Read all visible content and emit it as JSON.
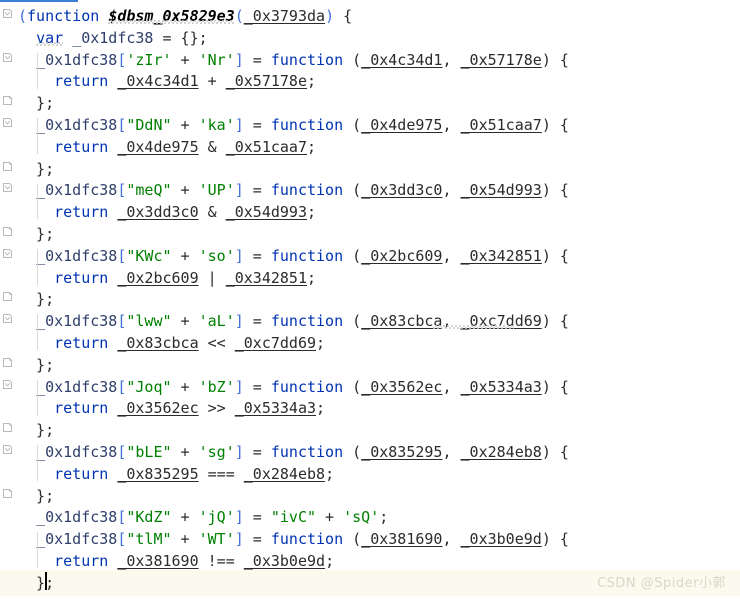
{
  "app": {
    "kind": "code-editor",
    "language": "JavaScript",
    "background": "#ffffff",
    "current_line_highlight": "#fcfaef",
    "accent": "#3a7fd5"
  },
  "colors": {
    "keyword": "#0033b3",
    "string": "#008000",
    "identifier": "#2f3f6b",
    "punctuation": "#3f6fd8",
    "plain": "#2b2b2b",
    "function_name": "#000000",
    "indent_guide": "#d8d8d8",
    "fold_marker": "#b9b9b9",
    "watermark": "#d9d6c8"
  },
  "watermark": {
    "text": "CSDN @Spider小郭"
  },
  "caret": {
    "line_index": 22,
    "column": 3
  },
  "gutter": {
    "markers": [
      {
        "line_index": 0,
        "icon": "fold-open-icon"
      },
      {
        "line_index": 2,
        "icon": "fold-open-icon"
      },
      {
        "line_index": 4,
        "icon": "fold-end-icon"
      },
      {
        "line_index": 5,
        "icon": "fold-open-icon"
      },
      {
        "line_index": 7,
        "icon": "fold-end-icon"
      },
      {
        "line_index": 8,
        "icon": "fold-open-icon"
      },
      {
        "line_index": 10,
        "icon": "fold-end-icon"
      },
      {
        "line_index": 11,
        "icon": "fold-open-icon"
      },
      {
        "line_index": 13,
        "icon": "fold-end-icon"
      },
      {
        "line_index": 14,
        "icon": "fold-open-icon"
      },
      {
        "line_index": 16,
        "icon": "fold-end-icon"
      },
      {
        "line_index": 17,
        "icon": "fold-open-icon"
      },
      {
        "line_index": 19,
        "icon": "fold-end-icon"
      },
      {
        "line_index": 20,
        "icon": "fold-open-icon"
      },
      {
        "line_index": 22,
        "icon": "fold-end-icon"
      }
    ]
  },
  "code": {
    "lines": [
      {
        "i": 0,
        "text": "(function $dbsm_0x5829e3(_0x3793da) {"
      },
      {
        "i": 1,
        "text": "  var _0x1dfc38 = {};"
      },
      {
        "i": 2,
        "text": "  _0x1dfc38['zIr' + 'Nr'] = function (_0x4c34d1, _0x57178e) {"
      },
      {
        "i": 3,
        "text": "    return _0x4c34d1 + _0x57178e;"
      },
      {
        "i": 4,
        "text": "  };"
      },
      {
        "i": 5,
        "text": "  _0x1dfc38[\"DdN\" + 'ka'] = function (_0x4de975, _0x51caa7) {"
      },
      {
        "i": 6,
        "text": "    return _0x4de975 & _0x51caa7;"
      },
      {
        "i": 7,
        "text": "  };"
      },
      {
        "i": 8,
        "text": "  _0x1dfc38[\"meQ\" + 'UP'] = function (_0x3dd3c0, _0x54d993) {"
      },
      {
        "i": 9,
        "text": "    return _0x3dd3c0 & _0x54d993;"
      },
      {
        "i": 10,
        "text": "  };"
      },
      {
        "i": 11,
        "text": "  _0x1dfc38[\"KWc\" + 'so'] = function (_0x2bc609, _0x342851) {"
      },
      {
        "i": 12,
        "text": "    return _0x2bc609 | _0x342851;"
      },
      {
        "i": 13,
        "text": "  };"
      },
      {
        "i": 14,
        "text": "  _0x1dfc38[\"lww\" + 'aL'] = function (_0x83cbca, _0xc7dd69) {"
      },
      {
        "i": 15,
        "text": "    return _0x83cbca << _0xc7dd69;"
      },
      {
        "i": 16,
        "text": "  };"
      },
      {
        "i": 17,
        "text": "  _0x1dfc38[\"Joq\" + 'bZ'] = function (_0x3562ec, _0x5334a3) {"
      },
      {
        "i": 18,
        "text": "    return _0x3562ec >> _0x5334a3;"
      },
      {
        "i": 19,
        "text": "  };"
      },
      {
        "i": 20,
        "text": "  _0x1dfc38[\"bLE\" + 'sg'] = function (_0x835295, _0x284eb8) {"
      },
      {
        "i": 21,
        "text": "    return _0x835295 === _0x284eb8;"
      },
      {
        "i": 22,
        "text": "  };"
      },
      {
        "i": 23,
        "text": "  _0x1dfc38[\"KdZ\" + 'jQ'] = \"ivC\" + 'sQ';"
      },
      {
        "i": 24,
        "text": "  _0x1dfc38[\"tlM\" + 'WT'] = function (_0x381690, _0x3b0e9d) {"
      },
      {
        "i": 25,
        "text": "    return _0x381690 !== _0x3b0e9d;"
      },
      {
        "i": 26,
        "text": "  };"
      }
    ],
    "tokens": [
      [
        {
          "t": "(",
          "c": "punct"
        },
        {
          "t": "function",
          "c": "kw"
        },
        {
          "t": " ",
          "c": "plain"
        },
        {
          "t": "$dbsm_0x5829e3",
          "c": "fnname"
        },
        {
          "t": "(",
          "c": "punct"
        },
        {
          "t": "_0x3793da",
          "c": "param"
        },
        {
          "t": ")",
          "c": "punct"
        },
        {
          "t": " {",
          "c": "plain"
        }
      ],
      [
        {
          "t": "  ",
          "c": "plain"
        },
        {
          "t": "var",
          "c": "kw"
        },
        {
          "t": " ",
          "c": "plain"
        },
        {
          "t": "_0x1dfc38",
          "c": "ident"
        },
        {
          "t": " = {};",
          "c": "plain"
        }
      ],
      [
        {
          "t": "  ",
          "c": "plain"
        },
        {
          "t": "_0x1dfc38",
          "c": "ident"
        },
        {
          "t": "[",
          "c": "punct"
        },
        {
          "t": "'zIr'",
          "c": "str"
        },
        {
          "t": " + ",
          "c": "plain"
        },
        {
          "t": "'Nr'",
          "c": "str"
        },
        {
          "t": "]",
          "c": "punct"
        },
        {
          "t": " = ",
          "c": "plain"
        },
        {
          "t": "function",
          "c": "kw"
        },
        {
          "t": " (",
          "c": "plain"
        },
        {
          "t": "_0x4c34d1",
          "c": "param"
        },
        {
          "t": ", ",
          "c": "plain"
        },
        {
          "t": "_0x57178e",
          "c": "param"
        },
        {
          "t": ") {",
          "c": "plain"
        }
      ],
      [
        {
          "t": "    ",
          "c": "plain"
        },
        {
          "t": "return",
          "c": "kw"
        },
        {
          "t": " ",
          "c": "plain"
        },
        {
          "t": "_0x4c34d1",
          "c": "param"
        },
        {
          "t": " + ",
          "c": "plain"
        },
        {
          "t": "_0x57178e",
          "c": "param"
        },
        {
          "t": ";",
          "c": "plain"
        }
      ],
      [
        {
          "t": "  };",
          "c": "plain"
        }
      ],
      [
        {
          "t": "  ",
          "c": "plain"
        },
        {
          "t": "_0x1dfc38",
          "c": "ident"
        },
        {
          "t": "[",
          "c": "punct"
        },
        {
          "t": "\"DdN\"",
          "c": "str"
        },
        {
          "t": " + ",
          "c": "plain"
        },
        {
          "t": "'ka'",
          "c": "str"
        },
        {
          "t": "]",
          "c": "punct"
        },
        {
          "t": " = ",
          "c": "plain"
        },
        {
          "t": "function",
          "c": "kw"
        },
        {
          "t": " (",
          "c": "plain"
        },
        {
          "t": "_0x4de975",
          "c": "param"
        },
        {
          "t": ", ",
          "c": "plain"
        },
        {
          "t": "_0x51caa7",
          "c": "param"
        },
        {
          "t": ") {",
          "c": "plain"
        }
      ],
      [
        {
          "t": "    ",
          "c": "plain"
        },
        {
          "t": "return",
          "c": "kw"
        },
        {
          "t": " ",
          "c": "plain"
        },
        {
          "t": "_0x4de975",
          "c": "param"
        },
        {
          "t": " & ",
          "c": "plain"
        },
        {
          "t": "_0x51caa7",
          "c": "param"
        },
        {
          "t": ";",
          "c": "plain"
        }
      ],
      [
        {
          "t": "  };",
          "c": "plain"
        }
      ],
      [
        {
          "t": "  ",
          "c": "plain"
        },
        {
          "t": "_0x1dfc38",
          "c": "ident"
        },
        {
          "t": "[",
          "c": "punct"
        },
        {
          "t": "\"meQ\"",
          "c": "str"
        },
        {
          "t": " + ",
          "c": "plain"
        },
        {
          "t": "'UP'",
          "c": "str"
        },
        {
          "t": "]",
          "c": "punct"
        },
        {
          "t": " = ",
          "c": "plain"
        },
        {
          "t": "function",
          "c": "kw"
        },
        {
          "t": " (",
          "c": "plain"
        },
        {
          "t": "_0x3dd3c0",
          "c": "param"
        },
        {
          "t": ", ",
          "c": "plain"
        },
        {
          "t": "_0x54d993",
          "c": "param"
        },
        {
          "t": ") {",
          "c": "plain"
        }
      ],
      [
        {
          "t": "    ",
          "c": "plain"
        },
        {
          "t": "return",
          "c": "kw"
        },
        {
          "t": " ",
          "c": "plain"
        },
        {
          "t": "_0x3dd3c0",
          "c": "param"
        },
        {
          "t": " & ",
          "c": "plain"
        },
        {
          "t": "_0x54d993",
          "c": "param"
        },
        {
          "t": ";",
          "c": "plain"
        }
      ],
      [
        {
          "t": "  };",
          "c": "plain"
        }
      ],
      [
        {
          "t": "  ",
          "c": "plain"
        },
        {
          "t": "_0x1dfc38",
          "c": "ident"
        },
        {
          "t": "[",
          "c": "punct"
        },
        {
          "t": "\"KWc\"",
          "c": "str"
        },
        {
          "t": " + ",
          "c": "plain"
        },
        {
          "t": "'so'",
          "c": "str"
        },
        {
          "t": "]",
          "c": "punct"
        },
        {
          "t": " = ",
          "c": "plain"
        },
        {
          "t": "function",
          "c": "kw"
        },
        {
          "t": " (",
          "c": "plain"
        },
        {
          "t": "_0x2bc609",
          "c": "param"
        },
        {
          "t": ", ",
          "c": "plain"
        },
        {
          "t": "_0x342851",
          "c": "param"
        },
        {
          "t": ") {",
          "c": "plain"
        }
      ],
      [
        {
          "t": "    ",
          "c": "plain"
        },
        {
          "t": "return",
          "c": "kw"
        },
        {
          "t": " ",
          "c": "plain"
        },
        {
          "t": "_0x2bc609",
          "c": "param"
        },
        {
          "t": " | ",
          "c": "plain"
        },
        {
          "t": "_0x342851",
          "c": "param"
        },
        {
          "t": ";",
          "c": "plain"
        }
      ],
      [
        {
          "t": "  };",
          "c": "plain"
        }
      ],
      [
        {
          "t": "  ",
          "c": "plain"
        },
        {
          "t": "_0x1dfc38",
          "c": "ident"
        },
        {
          "t": "[",
          "c": "punct"
        },
        {
          "t": "\"lww\"",
          "c": "str"
        },
        {
          "t": " + ",
          "c": "plain"
        },
        {
          "t": "'aL'",
          "c": "str"
        },
        {
          "t": "]",
          "c": "punct"
        },
        {
          "t": " = ",
          "c": "plain"
        },
        {
          "t": "function",
          "c": "kw"
        },
        {
          "t": " (",
          "c": "plain"
        },
        {
          "t": "_0x83cbca",
          "c": "param"
        },
        {
          "t": ", ",
          "c": "plain"
        },
        {
          "t": "_0xc7dd69",
          "c": "param"
        },
        {
          "t": ") {",
          "c": "plain"
        }
      ],
      [
        {
          "t": "    ",
          "c": "plain"
        },
        {
          "t": "return",
          "c": "kw"
        },
        {
          "t": " ",
          "c": "plain"
        },
        {
          "t": "_0x83cbca",
          "c": "param"
        },
        {
          "t": " << ",
          "c": "plain"
        },
        {
          "t": "_0xc7dd69",
          "c": "param"
        },
        {
          "t": ";",
          "c": "plain"
        }
      ],
      [
        {
          "t": "  };",
          "c": "plain"
        }
      ],
      [
        {
          "t": "  ",
          "c": "plain"
        },
        {
          "t": "_0x1dfc38",
          "c": "ident"
        },
        {
          "t": "[",
          "c": "punct"
        },
        {
          "t": "\"Joq\"",
          "c": "str"
        },
        {
          "t": " + ",
          "c": "plain"
        },
        {
          "t": "'bZ'",
          "c": "str"
        },
        {
          "t": "]",
          "c": "punct"
        },
        {
          "t": " = ",
          "c": "plain"
        },
        {
          "t": "function",
          "c": "kw"
        },
        {
          "t": " (",
          "c": "plain"
        },
        {
          "t": "_0x3562ec",
          "c": "param"
        },
        {
          "t": ", ",
          "c": "plain"
        },
        {
          "t": "_0x5334a3",
          "c": "param"
        },
        {
          "t": ") {",
          "c": "plain"
        }
      ],
      [
        {
          "t": "    ",
          "c": "plain"
        },
        {
          "t": "return",
          "c": "kw"
        },
        {
          "t": " ",
          "c": "plain"
        },
        {
          "t": "_0x3562ec",
          "c": "param"
        },
        {
          "t": " >> ",
          "c": "plain"
        },
        {
          "t": "_0x5334a3",
          "c": "param"
        },
        {
          "t": ";",
          "c": "plain"
        }
      ],
      [
        {
          "t": "  };",
          "c": "plain"
        }
      ],
      [
        {
          "t": "  ",
          "c": "plain"
        },
        {
          "t": "_0x1dfc38",
          "c": "ident"
        },
        {
          "t": "[",
          "c": "punct"
        },
        {
          "t": "\"bLE\"",
          "c": "str"
        },
        {
          "t": " + ",
          "c": "plain"
        },
        {
          "t": "'sg'",
          "c": "str"
        },
        {
          "t": "]",
          "c": "punct"
        },
        {
          "t": " = ",
          "c": "plain"
        },
        {
          "t": "function",
          "c": "kw"
        },
        {
          "t": " (",
          "c": "plain"
        },
        {
          "t": "_0x835295",
          "c": "param"
        },
        {
          "t": ", ",
          "c": "plain"
        },
        {
          "t": "_0x284eb8",
          "c": "param"
        },
        {
          "t": ") {",
          "c": "plain"
        }
      ],
      [
        {
          "t": "    ",
          "c": "plain"
        },
        {
          "t": "return",
          "c": "kw"
        },
        {
          "t": " ",
          "c": "plain"
        },
        {
          "t": "_0x835295",
          "c": "param"
        },
        {
          "t": " === ",
          "c": "plain"
        },
        {
          "t": "_0x284eb8",
          "c": "param"
        },
        {
          "t": ";",
          "c": "plain"
        }
      ],
      [
        {
          "t": "  };",
          "c": "plain"
        }
      ],
      [
        {
          "t": "  ",
          "c": "plain"
        },
        {
          "t": "_0x1dfc38",
          "c": "ident"
        },
        {
          "t": "[",
          "c": "punct"
        },
        {
          "t": "\"KdZ\"",
          "c": "str"
        },
        {
          "t": " + ",
          "c": "plain"
        },
        {
          "t": "'jQ'",
          "c": "str"
        },
        {
          "t": "]",
          "c": "punct"
        },
        {
          "t": " = ",
          "c": "plain"
        },
        {
          "t": "\"ivC\"",
          "c": "str"
        },
        {
          "t": " + ",
          "c": "plain"
        },
        {
          "t": "'sQ'",
          "c": "str"
        },
        {
          "t": ";",
          "c": "plain"
        }
      ],
      [
        {
          "t": "  ",
          "c": "plain"
        },
        {
          "t": "_0x1dfc38",
          "c": "ident"
        },
        {
          "t": "[",
          "c": "punct"
        },
        {
          "t": "\"tlM\"",
          "c": "str"
        },
        {
          "t": " + ",
          "c": "plain"
        },
        {
          "t": "'WT'",
          "c": "str"
        },
        {
          "t": "]",
          "c": "punct"
        },
        {
          "t": " = ",
          "c": "plain"
        },
        {
          "t": "function",
          "c": "kw"
        },
        {
          "t": " (",
          "c": "plain"
        },
        {
          "t": "_0x381690",
          "c": "param"
        },
        {
          "t": ", ",
          "c": "plain"
        },
        {
          "t": "_0x3b0e9d",
          "c": "param"
        },
        {
          "t": ") {",
          "c": "plain"
        }
      ],
      [
        {
          "t": "    ",
          "c": "plain"
        },
        {
          "t": "return",
          "c": "kw"
        },
        {
          "t": " ",
          "c": "plain"
        },
        {
          "t": "_0x381690",
          "c": "param"
        },
        {
          "t": " !== ",
          "c": "plain"
        },
        {
          "t": "_0x3b0e9d",
          "c": "param"
        },
        {
          "t": ";",
          "c": "plain"
        }
      ],
      [
        {
          "t": "  };",
          "c": "plain"
        }
      ]
    ]
  }
}
